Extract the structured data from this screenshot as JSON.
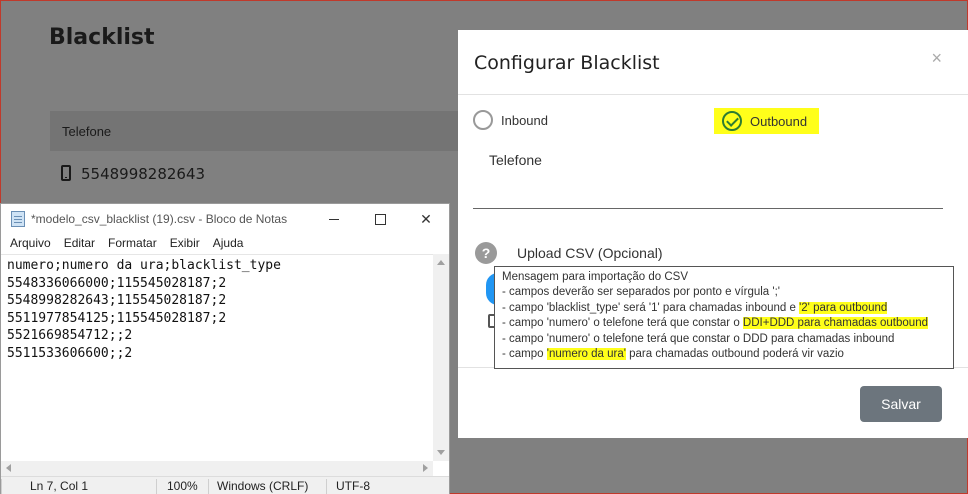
{
  "background": {
    "title": "Blacklist",
    "table_header": "Telefone",
    "row_phone": "5548998282643"
  },
  "modal": {
    "title": "Configurar Blacklist",
    "close": "×",
    "radio_inbound": "Inbound",
    "radio_outbound": "Outbound",
    "selected": "Outbound",
    "phone_label": "Telefone",
    "phone_value": "",
    "upload_label": "Upload CSV (Opcional)",
    "save_label": "Salvar"
  },
  "tooltip": {
    "line1": "Mensagem para importação do CSV",
    "line2": "- campos deverão ser separados por ponto e vírgula ';'",
    "line3_a": "- campo 'blacklist_type' será '1' para chamadas inbound e ",
    "line3_b": "'2' para outbound",
    "line4_a": "- campo 'numero' o telefone terá que constar o ",
    "line4_b": "DDI+DDD para chamadas outbound",
    "line5": "- campo 'numero' o telefone terá que constar o DDD para chamadas inbound",
    "line6_a": "- campo ",
    "line6_b": "'numero da ura'",
    "line6_c": " para chamadas outbound poderá vir vazio"
  },
  "notepad": {
    "title": "*modelo_csv_blacklist (19).csv - Bloco de Notas",
    "close": "✕",
    "menu": [
      "Arquivo",
      "Editar",
      "Formatar",
      "Exibir",
      "Ajuda"
    ],
    "lines": [
      "numero;numero da ura;blacklist_type",
      "5548336066000;115545028187;2",
      "5548998282643;115545028187;2",
      "5511977854125;115545028187;2",
      "5521669854712;;2",
      "5511533606600;;2"
    ],
    "status": {
      "position": "Ln 7, Col 1",
      "zoom": "100%",
      "line_ending": "Windows (CRLF)",
      "encoding": "UTF-8"
    }
  },
  "colors": {
    "highlight": "#ffff1a",
    "check_green": "#2e7d32",
    "save_button": "#6c757d"
  }
}
